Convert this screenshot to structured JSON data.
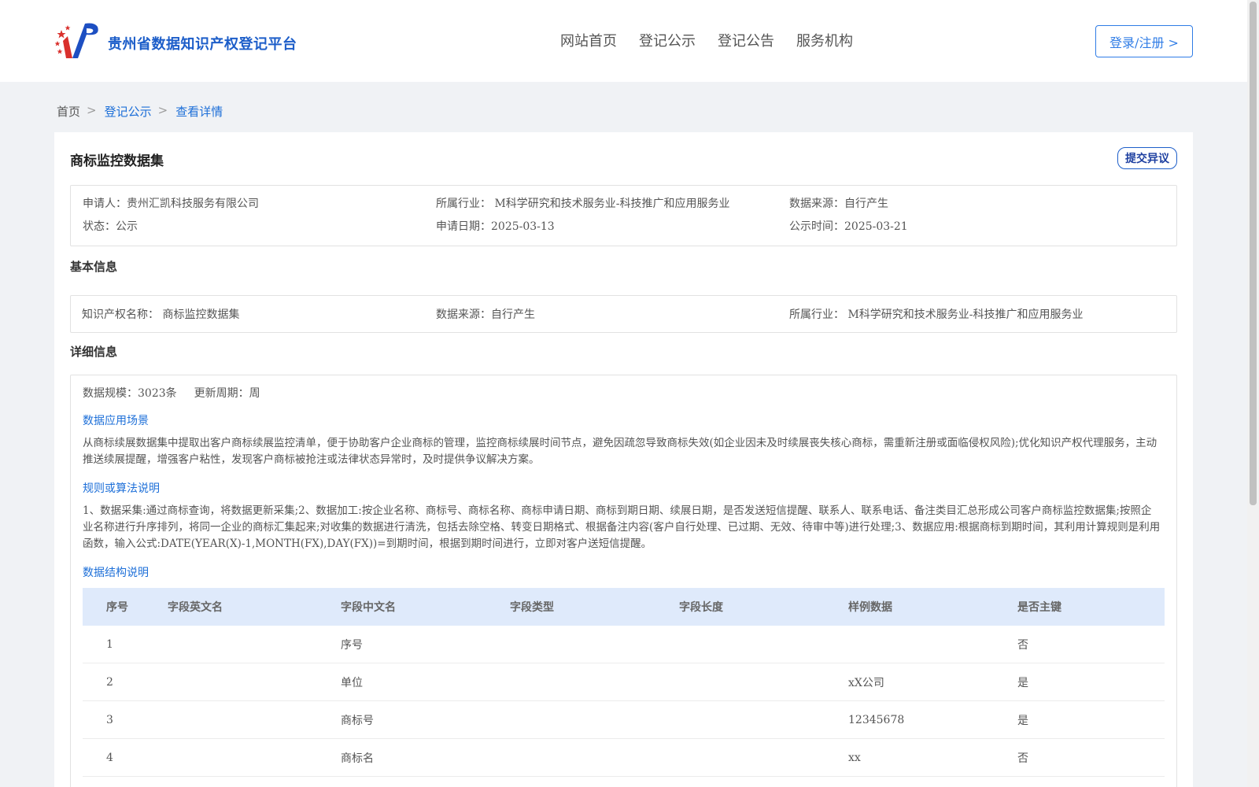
{
  "header": {
    "brand": "贵州省数据知识产权登记平台",
    "nav": [
      "网站首页",
      "登记公示",
      "登记公告",
      "服务机构"
    ],
    "login_label": "登录/注册 >"
  },
  "breadcrumb": {
    "home": "首页",
    "sep": ">",
    "items": [
      "登记公示",
      "查看详情"
    ]
  },
  "detail": {
    "title": "商标监控数据集",
    "objection_label": "提交异议",
    "summary": {
      "applicant_label": "申请人：",
      "applicant": "贵州汇凯科技服务有限公司",
      "industry_label": "所属行业：",
      "industry": "M科学研究和技术服务业-科技推广和应用服务业",
      "source_label": "数据来源：",
      "source": "自行产生",
      "status_label": "状态：",
      "status": "公示",
      "apply_date_label": "申请日期：",
      "apply_date": "2025-03-13",
      "publish_time_label": "公示时间：",
      "publish_time": "2025-03-21"
    },
    "basic_title": "基本信息",
    "basic": {
      "ip_name_label": "知识产权名称：",
      "ip_name": "商标监控数据集",
      "source_label": "数据来源：",
      "source": "自行产生",
      "industry_label": "所属行业：",
      "industry": "M科学研究和技术服务业-科技推广和应用服务业"
    },
    "detail_title": "详细信息",
    "scale_label": "数据规模：",
    "scale": "3023条",
    "cycle_label": "更新周期：",
    "cycle": "周",
    "scenario_title": "数据应用场景",
    "scenario_text": "从商标续展数据集中提取出客户商标续展监控清单，便于协助客户企业商标的管理，监控商标续展时间节点，避免因疏忽导致商标失效(如企业因未及时续展丧失核心商标，需重新注册或面临侵权风险);优化知识产权代理服务，主动推送续展提醒，增强客户粘性，发现客户商标被抢注或法律状态异常时，及时提供争议解决方案。",
    "rule_title": "规则或算法说明",
    "rule_text": "1、数据采集:通过商标查询，将数据更新采集;2、数据加工:按企业名称、商标号、商标名称、商标申请日期、商标到期日期、续展日期，是否发送短信提醒、联系人、联系电话、备注类目汇总形成公司客户商标监控数据集;按照企业名称进行升序排列，将同一企业的商标汇集起来;对收集的数据进行清洗，包括去除空格、转变日期格式、根据备注内容(客户自行处理、已过期、无效、待审中等)进行处理;3、数据应用:根据商标到期时间，其利用计算规则是利用函数，输入公式:DATE(YEAR(X)-1,MONTH(FX),DAY(FX))=到期时间，根据到期时间进行，立即对客户送短信提醒。",
    "structure_title": "数据结构说明",
    "table": {
      "headers": [
        "序号",
        "字段英文名",
        "字段中文名",
        "字段类型",
        "字段长度",
        "样例数据",
        "是否主键"
      ],
      "rows": [
        [
          "1",
          "",
          "序号",
          "",
          "",
          "",
          "否"
        ],
        [
          "2",
          "",
          "单位",
          "",
          "",
          "xX公司",
          "是"
        ],
        [
          "3",
          "",
          "商标号",
          "",
          "",
          "12345678",
          "是"
        ],
        [
          "4",
          "",
          "商标名",
          "",
          "",
          "xx",
          "否"
        ]
      ]
    }
  }
}
